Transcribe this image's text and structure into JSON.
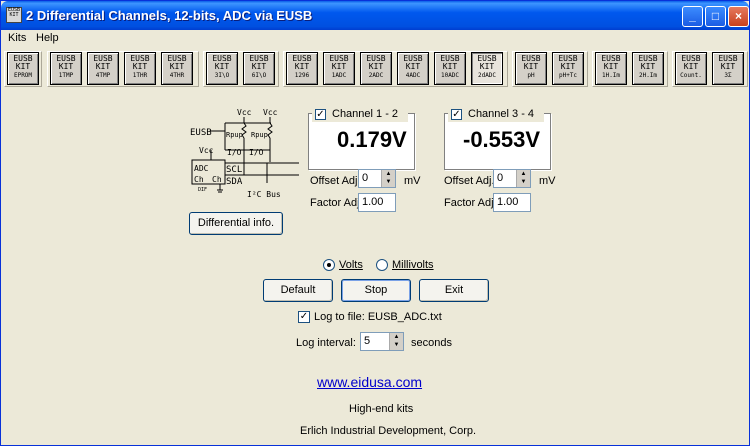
{
  "window": {
    "title": "2 Differential Channels, 12-bits, ADC via EUSB",
    "icon": "eusb-kit-icon",
    "controls": {
      "minimize": "_",
      "maximize": "□",
      "close": "×"
    }
  },
  "menu": {
    "items": [
      {
        "label": "Kits"
      },
      {
        "label": "Help"
      }
    ]
  },
  "toolbar": {
    "kits": [
      {
        "l1": "EUSB",
        "l2": "KIT",
        "l3": "EPROM"
      },
      {
        "l1": "EUSB",
        "l2": "KIT",
        "l3": "1TMP"
      },
      {
        "l1": "EUSB",
        "l2": "KIT",
        "l3": "4TMP"
      },
      {
        "l1": "EUSB",
        "l2": "KIT",
        "l3": "1THR"
      },
      {
        "l1": "EUSB",
        "l2": "KIT",
        "l3": "4THR"
      },
      {
        "l1": "EUSB",
        "l2": "KIT",
        "l3": "3I\\O"
      },
      {
        "l1": "EUSB",
        "l2": "KIT",
        "l3": "6I\\O"
      },
      {
        "l1": "EUSB",
        "l2": "KIT",
        "l3": "1296"
      },
      {
        "l1": "EUSB",
        "l2": "KIT",
        "l3": "1ADC"
      },
      {
        "l1": "EUSB",
        "l2": "KIT",
        "l3": "2ADC"
      },
      {
        "l1": "EUSB",
        "l2": "KIT",
        "l3": "4ADC"
      },
      {
        "l1": "EUSB",
        "l2": "KIT",
        "l3": "10ADC"
      },
      {
        "l1": "EUSB",
        "l2": "KIT",
        "l3": "2dADC"
      },
      {
        "l1": "EUSB",
        "l2": "KIT",
        "l3": "pH"
      },
      {
        "l1": "EUSB",
        "l2": "KIT",
        "l3": "pH+Tc"
      },
      {
        "l1": "EUSB",
        "l2": "KIT",
        "l3": "1H.Im"
      },
      {
        "l1": "EUSB",
        "l2": "KIT",
        "l3": "2H.Im"
      },
      {
        "l1": "EUSB",
        "l2": "KIT",
        "l3": "Count."
      },
      {
        "l1": "EUSB",
        "l2": "KIT",
        "l3": "3Σ"
      }
    ]
  },
  "diagram": {
    "vcc1": "Vcc",
    "vcc2": "Vcc",
    "vcc3": "Vcc",
    "eusb": "EUSB",
    "rpup1": "Rpup",
    "rpup2": "Rpup",
    "io1": "I/O",
    "io2": "I/O",
    "scl": "SCL",
    "sda": "SDA",
    "adc": "ADC",
    "ch1": "Ch",
    "ch2": "Ch",
    "dif": "DIF",
    "bus": "I²C Bus"
  },
  "differential_button": "Differential info.",
  "channel1": {
    "title": "Channel 1 - 2",
    "checked": true,
    "value": "0.179V",
    "offset_label": "Offset Adj.",
    "offset_value": "0",
    "offset_unit": "mV",
    "factor_label": "Factor Adj.",
    "factor_value": "1.00"
  },
  "channel2": {
    "title": "Channel 3 - 4",
    "checked": true,
    "value": "-0.553V",
    "offset_label": "Offset Adj.",
    "offset_value": "0",
    "offset_unit": "mV",
    "factor_label": "Factor Adj.",
    "factor_value": "1.00"
  },
  "units": {
    "volts": "Volts",
    "millivolts": "Millivolts",
    "selected": "Volts"
  },
  "buttons": {
    "default": "Default",
    "stop": "Stop",
    "exit": "Exit"
  },
  "log": {
    "checked": true,
    "label": "Log to file: EUSB_ADC.txt",
    "interval_label": "Log interval:",
    "interval_value": "5",
    "interval_unit": "seconds"
  },
  "footer": {
    "url": "www.eidusa.com",
    "tagline": "High-end kits",
    "company": "Erlich Industrial Development, Corp."
  }
}
